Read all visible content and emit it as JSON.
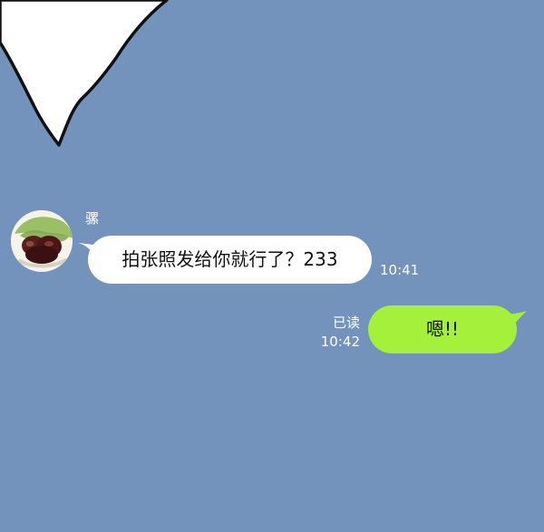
{
  "theme": {
    "background": "#7393bd",
    "incoming_bubble": "#ffffff",
    "outgoing_bubble": "#a4f03b",
    "meta_text": "#ffffff"
  },
  "conversation": {
    "incoming": {
      "sender_name": "骡",
      "avatar_icon": "food-avatar-icon",
      "message": "拍张照发给你就行了？233",
      "time": "10:41"
    },
    "outgoing": {
      "message": "嗯!!",
      "read_status": "已读",
      "time": "10:42"
    }
  }
}
